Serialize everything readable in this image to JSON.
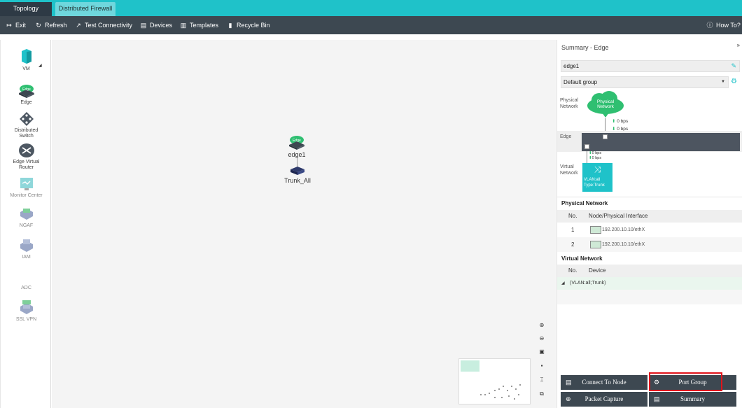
{
  "tabs": [
    {
      "label": "Topology",
      "active": true
    },
    {
      "label": "Distributed Firewall",
      "active": false
    }
  ],
  "toolbar": {
    "exit": "Exit",
    "refresh": "Refresh",
    "test_connectivity": "Test Connectivity",
    "devices": "Devices",
    "templates": "Templates",
    "recycle_bin": "Recycle Bin",
    "how_to": "How To?"
  },
  "palette": {
    "vm": "VM",
    "edge": "Edge",
    "distributed_switch_1": "Distributed",
    "distributed_switch_2": "Switch",
    "edge_router_1": "Edge Virtual",
    "edge_router_2": "Router",
    "monitor_center": "Monitor Center",
    "ngaf": "NGAF",
    "iam": "IAM",
    "adc": "ADC",
    "ssl_vpn": "SSL VPN"
  },
  "canvas": {
    "edge_node": "edge1",
    "trunk_node": "Trunk_All",
    "edge_badge": "Edge"
  },
  "panel": {
    "title": "Summary - Edge",
    "edge_name": "edge1",
    "group": "Default group",
    "physical_label_1": "Physical",
    "physical_label_2": "Network",
    "cloud_1": "Physical",
    "cloud_2": "Network",
    "up_bps": "0 bps",
    "down_bps": "0 bps",
    "edge_label": "Edge",
    "v_up_bps": "0 bps",
    "v_down_bps": "0 bps",
    "virtual_label_1": "Virtual",
    "virtual_label_2": "Network",
    "vlan": "VLAN:all",
    "vtype": "Type:Trunk",
    "physical_section": "Physical Network",
    "col_no": "No.",
    "col_node": "Node/Physical Interface",
    "physical_rows": [
      {
        "no": "1",
        "iface": "192.200.10.10/ethX"
      },
      {
        "no": "2",
        "iface": "192.200.10.10/ethX"
      }
    ],
    "virtual_section": "Virtual Network",
    "col_no2": "No.",
    "col_device": "Device",
    "virtual_row": "(VLAN:all;Trunk)"
  },
  "actions": {
    "connect": "Connect To Node",
    "port_group": "Port Group",
    "packet_capture": "Packet Capture",
    "summary": "Summary"
  },
  "colors": {
    "accent": "#1fc2c9",
    "toolbar": "#3d4851",
    "highlight": "#e0141b",
    "edge_green": "#2fbf71"
  }
}
